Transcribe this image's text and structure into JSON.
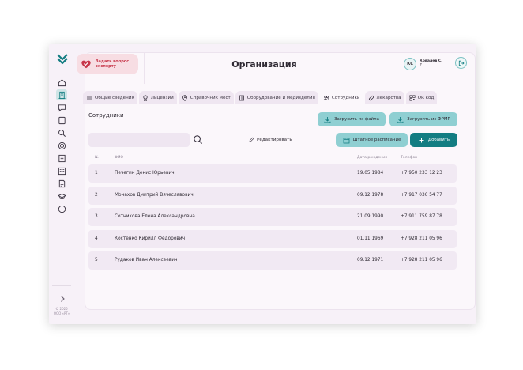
{
  "header": {
    "title": "Организация",
    "ask_expert": "Задать вопрос эксперту",
    "user_initials": "КС",
    "user_name": "Ковалев С. Г."
  },
  "sidebar": {
    "items": [
      "home-icon",
      "building-icon",
      "chat-icon",
      "book-icon",
      "search-icon",
      "target-icon",
      "list-icon",
      "reader-icon",
      "document-icon",
      "graduation-cap-icon",
      "info-icon"
    ],
    "active_index": 1,
    "copyright": [
      "© 2025",
      "ООО «RT»"
    ]
  },
  "tabs": [
    {
      "label": "Общие сведения",
      "icon": "list-icon"
    },
    {
      "label": "Лицензии",
      "icon": "award-icon"
    },
    {
      "label": "Справочник мест",
      "icon": "location-pin-icon"
    },
    {
      "label": "Оборудование и медизделия",
      "icon": "equipment-icon"
    },
    {
      "label": "Сотрудники",
      "icon": "users-icon",
      "active": true
    },
    {
      "label": "Лекарства",
      "icon": "pill-icon"
    },
    {
      "label": "QR код",
      "icon": "qr-code-icon"
    }
  ],
  "section": {
    "title": "Сотрудники",
    "upload_file": "Загрузить из файла",
    "upload_frmr": "Загрузить из ФРМР",
    "staffing": "Штатное расписание",
    "add": "Добавить",
    "edit": "Редактировать",
    "search_placeholder": ""
  },
  "table": {
    "columns": [
      "№",
      "ФИО",
      "Дата рождения",
      "Телефон"
    ],
    "rows": [
      {
        "n": "1",
        "name": "Печегин Денис Юрьевич",
        "birth": "19.05.1984",
        "phone": "+7 950 233 12 23"
      },
      {
        "n": "2",
        "name": "Монахов Дмитрий Вячеславович",
        "birth": "09.12.1978",
        "phone": "+7 917 036 54 77"
      },
      {
        "n": "3",
        "name": "Сотникова Елена Александровна",
        "birth": "21.09.1990",
        "phone": "+7 911 759 87 78"
      },
      {
        "n": "4",
        "name": "Костенко Кирилл Федорович",
        "birth": "01.11.1969",
        "phone": "+7 928 211 05 96"
      },
      {
        "n": "5",
        "name": "Рудаков Иван Алексеевич",
        "birth": "09.12.1971",
        "phone": "+7 928 211 05 96"
      }
    ]
  },
  "colors": {
    "accent": "#137d82",
    "accent_light": "#8fcfd2",
    "ask_bg": "#f7dde3",
    "ask_text": "#c7364a",
    "row_bg": "#f1e9f3"
  }
}
